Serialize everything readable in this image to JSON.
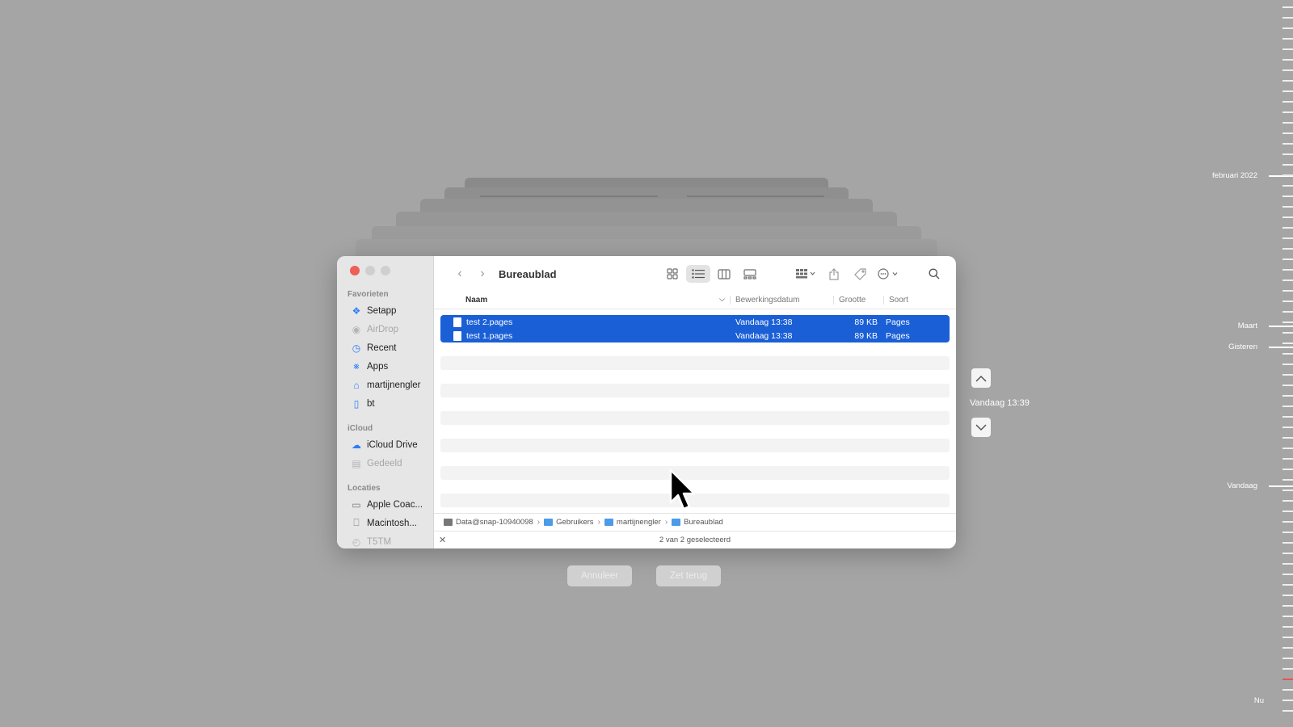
{
  "window": {
    "title": "Bureaublad"
  },
  "sidebar": {
    "sections": [
      {
        "label": "Favorieten",
        "items": [
          {
            "label": "Setapp",
            "icon": "setapp-icon",
            "dim": false
          },
          {
            "label": "AirDrop",
            "icon": "airdrop-icon",
            "dim": true
          },
          {
            "label": "Recent",
            "icon": "clock-icon",
            "dim": false
          },
          {
            "label": "Apps",
            "icon": "apps-icon",
            "dim": false
          },
          {
            "label": "martijnengler",
            "icon": "home-icon",
            "dim": false
          },
          {
            "label": "bt",
            "icon": "document-icon",
            "dim": false
          }
        ]
      },
      {
        "label": "iCloud",
        "items": [
          {
            "label": "iCloud Drive",
            "icon": "cloud-icon",
            "dim": false
          },
          {
            "label": "Gedeeld",
            "icon": "shared-folder-icon",
            "dim": true
          }
        ]
      },
      {
        "label": "Locaties",
        "items": [
          {
            "label": "Apple Coac...",
            "icon": "display-icon",
            "dim": false
          },
          {
            "label": "Macintosh...",
            "icon": "disk-icon",
            "dim": false
          },
          {
            "label": "T5TM",
            "icon": "time-machine-icon",
            "dim": true
          }
        ]
      }
    ]
  },
  "columns": {
    "name": "Naam",
    "date": "Bewerkingsdatum",
    "size": "Grootte",
    "kind": "Soort"
  },
  "files": [
    {
      "name": "test 2.pages",
      "date": "Vandaag 13:38",
      "size": "89 KB",
      "kind": "Pages"
    },
    {
      "name": "test 1.pages",
      "date": "Vandaag 13:38",
      "size": "89 KB",
      "kind": "Pages"
    }
  ],
  "pathbar": [
    {
      "label": "Data@snap-10940098",
      "type": "disk"
    },
    {
      "label": "Gebruikers",
      "type": "folder"
    },
    {
      "label": "martijnengler",
      "type": "folder"
    },
    {
      "label": "Bureaublad",
      "type": "folder"
    }
  ],
  "status": "2 van 2 geselecteerd",
  "buttons": {
    "cancel": "Annuleer",
    "restore": "Zet terug"
  },
  "snapshot_time": "Vandaag 13:39",
  "timeline": {
    "labels": {
      "feb": "februari 2022",
      "maart": "Maart",
      "gisteren": "Gisteren",
      "vandaag": "Vandaag",
      "nu": "Nu"
    }
  },
  "colors": {
    "selection": "#1a5fd6",
    "close": "#ed5f57",
    "accent": "#2f7cf6"
  }
}
